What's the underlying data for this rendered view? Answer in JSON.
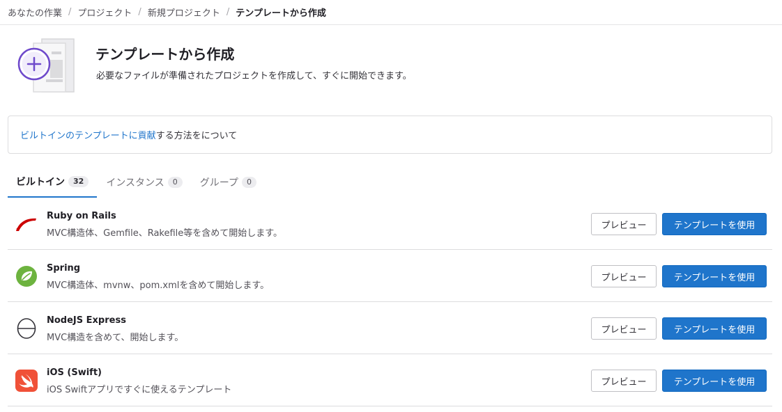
{
  "breadcrumb": {
    "items": [
      "あなたの作業",
      "プロジェクト",
      "新規プロジェクト",
      "テンプレートから作成"
    ],
    "separator": "/"
  },
  "header": {
    "title": "テンプレートから作成",
    "description": "必要なファイルが準備されたプロジェクトを作成して、すぐに開始できます。",
    "illustration_icon": "plus-document-icon"
  },
  "info": {
    "link_text": "ビルトインのテンプレートに貢献",
    "text": "する方法をについて"
  },
  "tabs": [
    {
      "label": "ビルトイン",
      "count": "32",
      "active": true
    },
    {
      "label": "インスタンス",
      "count": "0",
      "active": false
    },
    {
      "label": "グループ",
      "count": "0",
      "active": false
    }
  ],
  "templates": [
    {
      "name": "Ruby on Rails",
      "description": "MVC構造体、Gemfile、Rakefile等を含めて開始します。",
      "icon": "rails-icon",
      "preview_label": "プレビュー",
      "use_label": "テンプレートを使用"
    },
    {
      "name": "Spring",
      "description": "MVC構造体、mvnw、pom.xmlを含めて開始します。",
      "icon": "spring-icon",
      "preview_label": "プレビュー",
      "use_label": "テンプレートを使用"
    },
    {
      "name": "NodeJS Express",
      "description": "MVC構造を含めて、開始します。",
      "icon": "express-icon",
      "preview_label": "プレビュー",
      "use_label": "テンプレートを使用"
    },
    {
      "name": "iOS (Swift)",
      "description": "iOS Swiftアプリですぐに使えるテンプレート",
      "icon": "swift-icon",
      "preview_label": "プレビュー",
      "use_label": "テンプレートを使用"
    }
  ],
  "colors": {
    "primary": "#1f75cb",
    "rails": "#cc0000",
    "spring": "#6db33f",
    "swift": "#f05138",
    "illustration_purple": "#6e49cb"
  }
}
